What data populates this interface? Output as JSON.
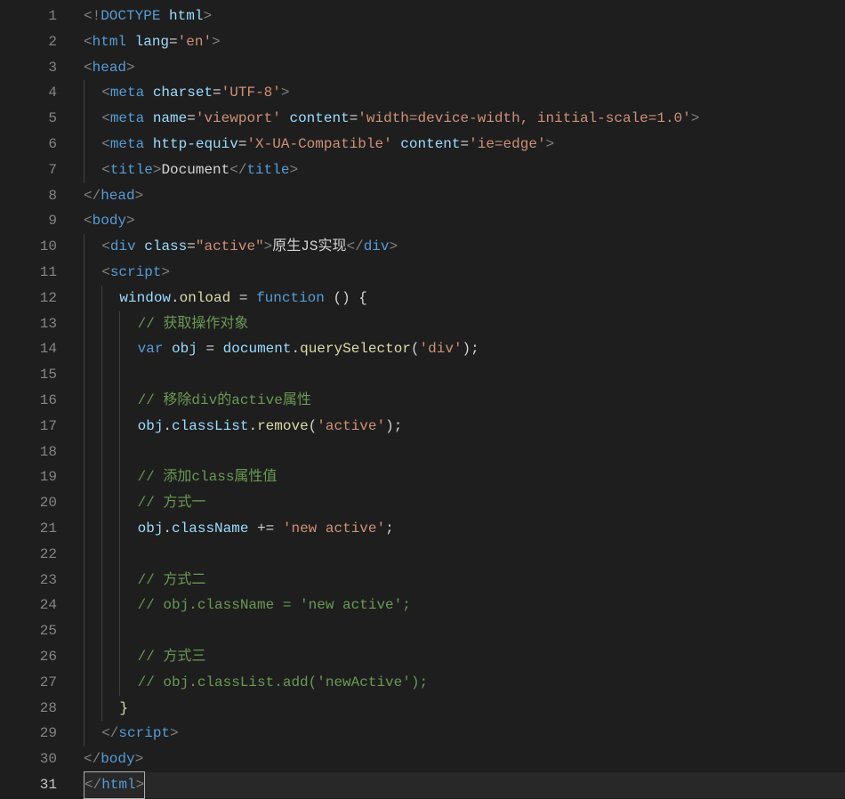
{
  "total_lines": 31,
  "active_line": 31,
  "lines": {
    "1": {
      "indent": 0,
      "t": [
        [
          "br",
          "<!"
        ],
        [
          "tag",
          "DOCTYPE"
        ],
        [
          "txt",
          " "
        ],
        [
          "attr",
          "html"
        ],
        [
          "br",
          ">"
        ]
      ]
    },
    "2": {
      "indent": 0,
      "t": [
        [
          "br",
          "<"
        ],
        [
          "tag",
          "html"
        ],
        [
          "txt",
          " "
        ],
        [
          "attr",
          "lang"
        ],
        [
          "txt",
          "="
        ],
        [
          "str",
          "'en'"
        ],
        [
          "br",
          ">"
        ]
      ]
    },
    "3": {
      "indent": 0,
      "t": [
        [
          "br",
          "<"
        ],
        [
          "tag",
          "head"
        ],
        [
          "br",
          ">"
        ]
      ]
    },
    "4": {
      "indent": 1,
      "t": [
        [
          "br",
          "<"
        ],
        [
          "tag",
          "meta"
        ],
        [
          "txt",
          " "
        ],
        [
          "attr",
          "charset"
        ],
        [
          "txt",
          "="
        ],
        [
          "str",
          "'UTF-8'"
        ],
        [
          "br",
          ">"
        ]
      ]
    },
    "5": {
      "indent": 1,
      "t": [
        [
          "br",
          "<"
        ],
        [
          "tag",
          "meta"
        ],
        [
          "txt",
          " "
        ],
        [
          "attr",
          "name"
        ],
        [
          "txt",
          "="
        ],
        [
          "str",
          "'viewport'"
        ],
        [
          "txt",
          " "
        ],
        [
          "attr",
          "content"
        ],
        [
          "txt",
          "="
        ],
        [
          "str",
          "'width=device-width, initial-scale=1.0'"
        ],
        [
          "br",
          ">"
        ]
      ]
    },
    "6": {
      "indent": 1,
      "t": [
        [
          "br",
          "<"
        ],
        [
          "tag",
          "meta"
        ],
        [
          "txt",
          " "
        ],
        [
          "attr",
          "http-equiv"
        ],
        [
          "txt",
          "="
        ],
        [
          "str",
          "'X-UA-Compatible'"
        ],
        [
          "txt",
          " "
        ],
        [
          "attr",
          "content"
        ],
        [
          "txt",
          "="
        ],
        [
          "str",
          "'ie=edge'"
        ],
        [
          "br",
          ">"
        ]
      ]
    },
    "7": {
      "indent": 1,
      "t": [
        [
          "br",
          "<"
        ],
        [
          "tag",
          "title"
        ],
        [
          "br",
          ">"
        ],
        [
          "txt",
          "Document"
        ],
        [
          "br",
          "</"
        ],
        [
          "tag",
          "title"
        ],
        [
          "br",
          ">"
        ]
      ]
    },
    "8": {
      "indent": 0,
      "t": [
        [
          "br",
          "</"
        ],
        [
          "tag",
          "head"
        ],
        [
          "br",
          ">"
        ]
      ]
    },
    "9": {
      "indent": 0,
      "t": [
        [
          "br",
          "<"
        ],
        [
          "tag",
          "body"
        ],
        [
          "br",
          ">"
        ]
      ]
    },
    "10": {
      "indent": 1,
      "t": [
        [
          "br",
          "<"
        ],
        [
          "tag",
          "div"
        ],
        [
          "txt",
          " "
        ],
        [
          "attr",
          "class"
        ],
        [
          "txt",
          "="
        ],
        [
          "str",
          "\"active\""
        ],
        [
          "br",
          ">"
        ],
        [
          "txt",
          "原生JS实现"
        ],
        [
          "br",
          "</"
        ],
        [
          "tag",
          "div"
        ],
        [
          "br",
          ">"
        ]
      ]
    },
    "11": {
      "indent": 1,
      "t": [
        [
          "br",
          "<"
        ],
        [
          "tag",
          "script"
        ],
        [
          "br",
          ">"
        ]
      ]
    },
    "12": {
      "indent": 2,
      "t": [
        [
          "var",
          "window"
        ],
        [
          "punc",
          "."
        ],
        [
          "fn",
          "onload"
        ],
        [
          "txt",
          " "
        ],
        [
          "punc",
          "="
        ],
        [
          "txt",
          " "
        ],
        [
          "kw",
          "function"
        ],
        [
          "txt",
          " "
        ],
        [
          "punc",
          "()"
        ],
        [
          "txt",
          " "
        ],
        [
          "punc",
          "{"
        ]
      ]
    },
    "13": {
      "indent": 3,
      "t": [
        [
          "com",
          "// 获取操作对象"
        ]
      ]
    },
    "14": {
      "indent": 3,
      "t": [
        [
          "kw",
          "var"
        ],
        [
          "txt",
          " "
        ],
        [
          "var",
          "obj"
        ],
        [
          "txt",
          " "
        ],
        [
          "punc",
          "="
        ],
        [
          "txt",
          " "
        ],
        [
          "var",
          "document"
        ],
        [
          "punc",
          "."
        ],
        [
          "fn",
          "querySelector"
        ],
        [
          "punc",
          "("
        ],
        [
          "str",
          "'div'"
        ],
        [
          "punc",
          ");"
        ]
      ]
    },
    "15": {
      "indent": 0,
      "t": []
    },
    "16": {
      "indent": 3,
      "t": [
        [
          "com",
          "// 移除div的active属性"
        ]
      ]
    },
    "17": {
      "indent": 3,
      "t": [
        [
          "var",
          "obj"
        ],
        [
          "punc",
          "."
        ],
        [
          "var",
          "classList"
        ],
        [
          "punc",
          "."
        ],
        [
          "fn",
          "remove"
        ],
        [
          "punc",
          "("
        ],
        [
          "str",
          "'active'"
        ],
        [
          "punc",
          ");"
        ]
      ]
    },
    "18": {
      "indent": 0,
      "t": []
    },
    "19": {
      "indent": 3,
      "t": [
        [
          "com",
          "// 添加class属性值"
        ]
      ]
    },
    "20": {
      "indent": 3,
      "t": [
        [
          "com",
          "// 方式一"
        ]
      ]
    },
    "21": {
      "indent": 3,
      "t": [
        [
          "var",
          "obj"
        ],
        [
          "punc",
          "."
        ],
        [
          "var",
          "className"
        ],
        [
          "txt",
          " "
        ],
        [
          "punc",
          "+="
        ],
        [
          "txt",
          " "
        ],
        [
          "str",
          "'new active'"
        ],
        [
          "punc",
          ";"
        ]
      ]
    },
    "22": {
      "indent": 0,
      "t": []
    },
    "23": {
      "indent": 3,
      "t": [
        [
          "com",
          "// 方式二"
        ]
      ]
    },
    "24": {
      "indent": 3,
      "t": [
        [
          "com",
          "// obj.className = 'new active';"
        ]
      ]
    },
    "25": {
      "indent": 0,
      "t": []
    },
    "26": {
      "indent": 3,
      "t": [
        [
          "com",
          "// 方式三"
        ]
      ]
    },
    "27": {
      "indent": 3,
      "t": [
        [
          "com",
          "// obj.classList.add('newActive');"
        ]
      ]
    },
    "28": {
      "indent": 2,
      "t": [
        [
          "fn",
          "}"
        ]
      ]
    },
    "29": {
      "indent": 1,
      "t": [
        [
          "br",
          "</"
        ],
        [
          "tag",
          "script"
        ],
        [
          "br",
          ">"
        ]
      ]
    },
    "30": {
      "indent": 0,
      "t": [
        [
          "br",
          "</"
        ],
        [
          "tag",
          "body"
        ],
        [
          "br",
          ">"
        ]
      ]
    },
    "31": {
      "indent": 0,
      "cursor": true,
      "t": [
        [
          "br",
          "</"
        ],
        [
          "tag",
          "html"
        ],
        [
          "br",
          ">"
        ]
      ]
    }
  },
  "guides": {
    "4": [
      0
    ],
    "5": [
      0
    ],
    "6": [
      0
    ],
    "7": [
      0
    ],
    "10": [
      0
    ],
    "11": [
      0
    ],
    "12": [
      0,
      1
    ],
    "13": [
      0,
      1,
      2
    ],
    "14": [
      0,
      1,
      2
    ],
    "15": [
      0,
      1,
      2
    ],
    "16": [
      0,
      1,
      2
    ],
    "17": [
      0,
      1,
      2
    ],
    "18": [
      0,
      1,
      2
    ],
    "19": [
      0,
      1,
      2
    ],
    "20": [
      0,
      1,
      2
    ],
    "21": [
      0,
      1,
      2
    ],
    "22": [
      0,
      1,
      2
    ],
    "23": [
      0,
      1,
      2
    ],
    "24": [
      0,
      1,
      2
    ],
    "25": [
      0,
      1,
      2
    ],
    "26": [
      0,
      1,
      2
    ],
    "27": [
      0,
      1,
      2
    ],
    "28": [
      0,
      1
    ],
    "29": [
      0
    ]
  },
  "indent_unit": "  "
}
